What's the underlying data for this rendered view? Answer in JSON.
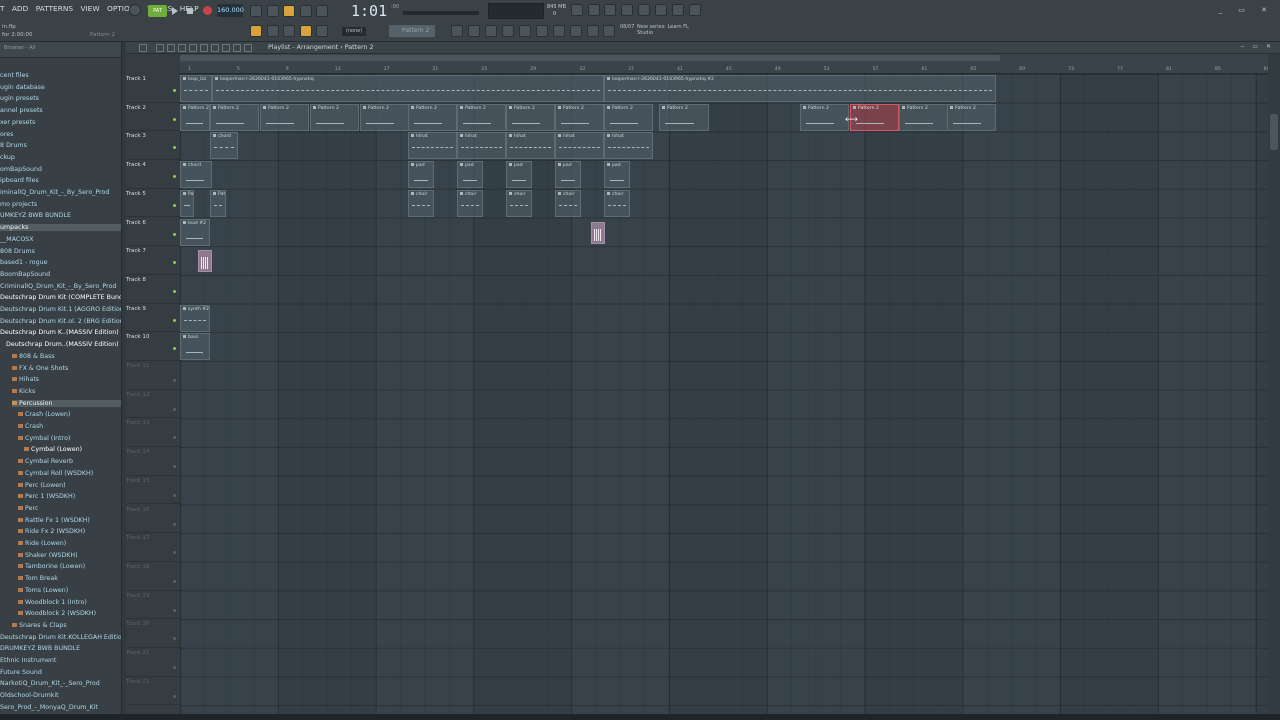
{
  "menu": [
    "T",
    "ADD",
    "PATTERNS",
    "VIEW",
    "OPTIONS",
    "TOOLS",
    "HELP"
  ],
  "hint": {
    "line1": "in.flp",
    "line2": "for 2:00:00",
    "pattern_label": "Pattern 2"
  },
  "transport": {
    "pattern_mode": "PAT",
    "tempo": "160.000",
    "time": "1:01",
    "time_sub": ":00"
  },
  "cpu": {
    "line1": "845 MB",
    "line2": "0"
  },
  "snap": "(none)",
  "pattern_selector": "Pattern 2",
  "news": {
    "date": "08/07",
    "text": "New series: Learn FL Studio"
  },
  "window_controls": "_ ▭ ✕",
  "browser": {
    "header": "Browser - All",
    "items": [
      {
        "label": "cent files",
        "depth": 0
      },
      {
        "label": "ugin database",
        "depth": 0
      },
      {
        "label": "ugin presets",
        "depth": 0
      },
      {
        "label": "annel presets",
        "depth": 0
      },
      {
        "label": "xer presets",
        "depth": 0
      },
      {
        "label": "ores",
        "depth": 0
      },
      {
        "label": "8 Drums",
        "depth": 0
      },
      {
        "label": "ckup",
        "depth": 0
      },
      {
        "label": "omBapSound",
        "depth": 0
      },
      {
        "label": "ipboard files",
        "depth": 0
      },
      {
        "label": "iminalIQ_Drum_Kit_-_By_Sero_Prod",
        "depth": 0
      },
      {
        "label": "mo projects",
        "depth": 0
      },
      {
        "label": "UMKEYZ BWB BUNDLE",
        "depth": 0
      },
      {
        "label": "umpacks",
        "depth": 0,
        "selected": true
      },
      {
        "label": "__MACOSX",
        "depth": 0
      },
      {
        "label": "808 Drums",
        "depth": 0
      },
      {
        "label": "based1 - rogue",
        "depth": 0
      },
      {
        "label": "BoomBapSound",
        "depth": 0
      },
      {
        "label": "CriminalIQ_Drum_Kit_-_By_Sero_Prod",
        "depth": 0
      },
      {
        "label": "Deutschrap Drum Kit (COMPLETE Bundle)",
        "depth": 0,
        "current": true
      },
      {
        "label": "Deutschrap Drum Kit.1 (AGGRO Edition)",
        "depth": 0
      },
      {
        "label": "Deutschrap Drum Kit.ol. 2 (BRG Edition)",
        "depth": 0
      },
      {
        "label": "Deutschrap Drum K..(MASSIV Edition)",
        "depth": 0,
        "current": true
      },
      {
        "label": "Deutschrap Drum..(MASSIV Edition)",
        "depth": 1,
        "current": true
      },
      {
        "label": "808 & Bass",
        "depth": 2
      },
      {
        "label": "FX & One Shots",
        "depth": 2
      },
      {
        "label": "Hihats",
        "depth": 2
      },
      {
        "label": "Kicks",
        "depth": 2
      },
      {
        "label": "Percussion",
        "depth": 2,
        "selected": true
      },
      {
        "label": "Crash (Lowen)",
        "depth": 3
      },
      {
        "label": "Crash",
        "depth": 3
      },
      {
        "label": "Cymbal (Intro)",
        "depth": 3
      },
      {
        "label": "Cymbal (Lowen)",
        "depth": 4,
        "current": true
      },
      {
        "label": "Cymbal Reverb",
        "depth": 3
      },
      {
        "label": "Cymbal Roll (WSDKH)",
        "depth": 3
      },
      {
        "label": "Perc (Lowen)",
        "depth": 3
      },
      {
        "label": "Perc 1 (WSDKH)",
        "depth": 3
      },
      {
        "label": "Perc",
        "depth": 3
      },
      {
        "label": "Rattle Fx 1 (WSDKH)",
        "depth": 3
      },
      {
        "label": "Ride Fx 2 (WSDKH)",
        "depth": 3
      },
      {
        "label": "Ride (Lowen)",
        "depth": 3
      },
      {
        "label": "Shaker (WSDKH)",
        "depth": 3
      },
      {
        "label": "Tamborine (Lowen)",
        "depth": 3
      },
      {
        "label": "Tom Break",
        "depth": 3
      },
      {
        "label": "Toms (Lowen)",
        "depth": 3
      },
      {
        "label": "Woodblock 1 (Intro)",
        "depth": 3
      },
      {
        "label": "Woodblock 2 (WSDKH)",
        "depth": 3
      },
      {
        "label": "Snares & Claps",
        "depth": 2
      },
      {
        "label": "Deutschrap Drum Kit.KOLLEGAH Edition)",
        "depth": 0
      },
      {
        "label": "DRUMKEYZ BWB BUNDLE",
        "depth": 0
      },
      {
        "label": "Ethnic Instrument",
        "depth": 0
      },
      {
        "label": "Future Sound",
        "depth": 0
      },
      {
        "label": "NarkotiQ_Drum_Kit_-_Sero_Prod",
        "depth": 0
      },
      {
        "label": "Oldschool-Drumkit",
        "depth": 0
      },
      {
        "label": "Sero_Prod_-_MonyaQ_Drum_Kit",
        "depth": 0
      }
    ]
  },
  "playlist": {
    "title": "Playlist - Arrangement",
    "separator": "›",
    "pattern": "Pattern 2",
    "tracks": [
      "Track 1",
      "Track 2",
      "Track 3",
      "Track 4",
      "Track 5",
      "Track 6",
      "Track 7",
      "Track 8",
      "Track 9",
      "Track 10",
      "Track 11",
      "Track 12",
      "Track 13",
      "Track 14",
      "Track 15",
      "Track 16",
      "Track 17",
      "Track 18",
      "Track 19",
      "Track 20",
      "Track 21",
      "Track 22"
    ],
    "bars": [
      "1",
      "5",
      "9",
      "13",
      "17",
      "21",
      "25",
      "29",
      "33",
      "37",
      "41",
      "45",
      "49",
      "53",
      "57",
      "61",
      "65",
      "69",
      "73",
      "77",
      "81",
      "85",
      "89",
      "93",
      "97",
      "101"
    ],
    "audio_labels": {
      "top_left": "loop_lzz",
      "top_center": "looperman-l-2626041-0163965-hypnotiq",
      "top_right": "looperman-l-2626041-0163965-hypnotiq #2"
    },
    "clip_labels": {
      "pattern": "Pattern 2",
      "chord": "chord",
      "hihat": "hihat",
      "pad": "pad",
      "choir": "choir",
      "lead": "lead #2",
      "synth": "synth #2",
      "bass": "bass"
    }
  }
}
